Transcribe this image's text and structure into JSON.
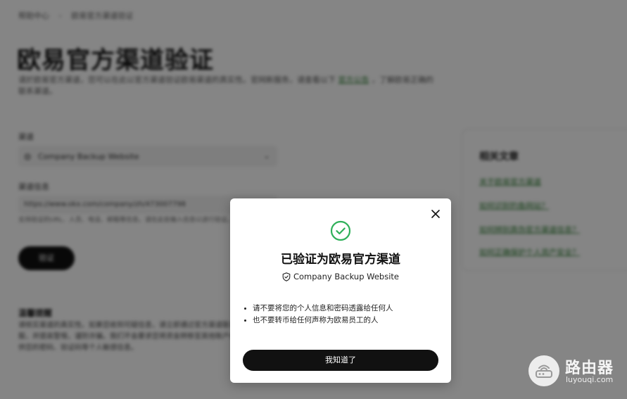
{
  "background": {
    "breadcrumb": [
      "帮助中心",
      "欧易官方渠道验证"
    ],
    "page_title": "欧易官方渠道验证",
    "intro_text": "请於欧易官方渠道，您可以在此以官方渠道验证欧易渠道的真实性。官网新服务，请查看以下",
    "intro_link": "官方公告",
    "intro_tail": "，了解欧易正确的联系渠道。",
    "channel_label": "渠道",
    "channel_value": "Company Backup Website",
    "info_label": "渠道信息",
    "info_value": "https://www.okx.com/company/zh/473007798",
    "hint_text": "支持验证的URL、人员、电话、邮箱等信息。请在此处输入信息以进行验证。",
    "verify_label": "验证",
    "notice_title": "温馨提醒",
    "notice_text": "请核实渠道的真实性。如果您收到可疑信息，请立即通过官方渠道联系客服，并提高警惕，谨防诈骗。我们不会要求您将资金转移至其他账户或提供您的密码、验证码等个人敏感信息。",
    "side_title": "相关文章",
    "side_links": [
      "关于欧易官方渠道",
      "如何识别钓鱼网站？",
      "如何辨别真伪官方渠道信息？",
      "如何正确保护个人资产安全？"
    ]
  },
  "modal": {
    "title": "已验证为欧易官方渠道",
    "channel": "Company Backup Website",
    "tips": [
      "请不要将您的个人信息和密码透露给任何人",
      "也不要转币给任何声称为欧易员工的人"
    ],
    "confirm_label": "我知道了"
  },
  "watermark": {
    "name": "路由器",
    "domain": "luyouqi.com"
  },
  "colors": {
    "success": "#2fb05a",
    "button": "#111111",
    "overlay": "rgba(0,0,0,0.48)"
  },
  "icons": [
    "check-circle-icon",
    "close-icon",
    "shield-icon",
    "globe-icon",
    "chevron-down-icon"
  ]
}
